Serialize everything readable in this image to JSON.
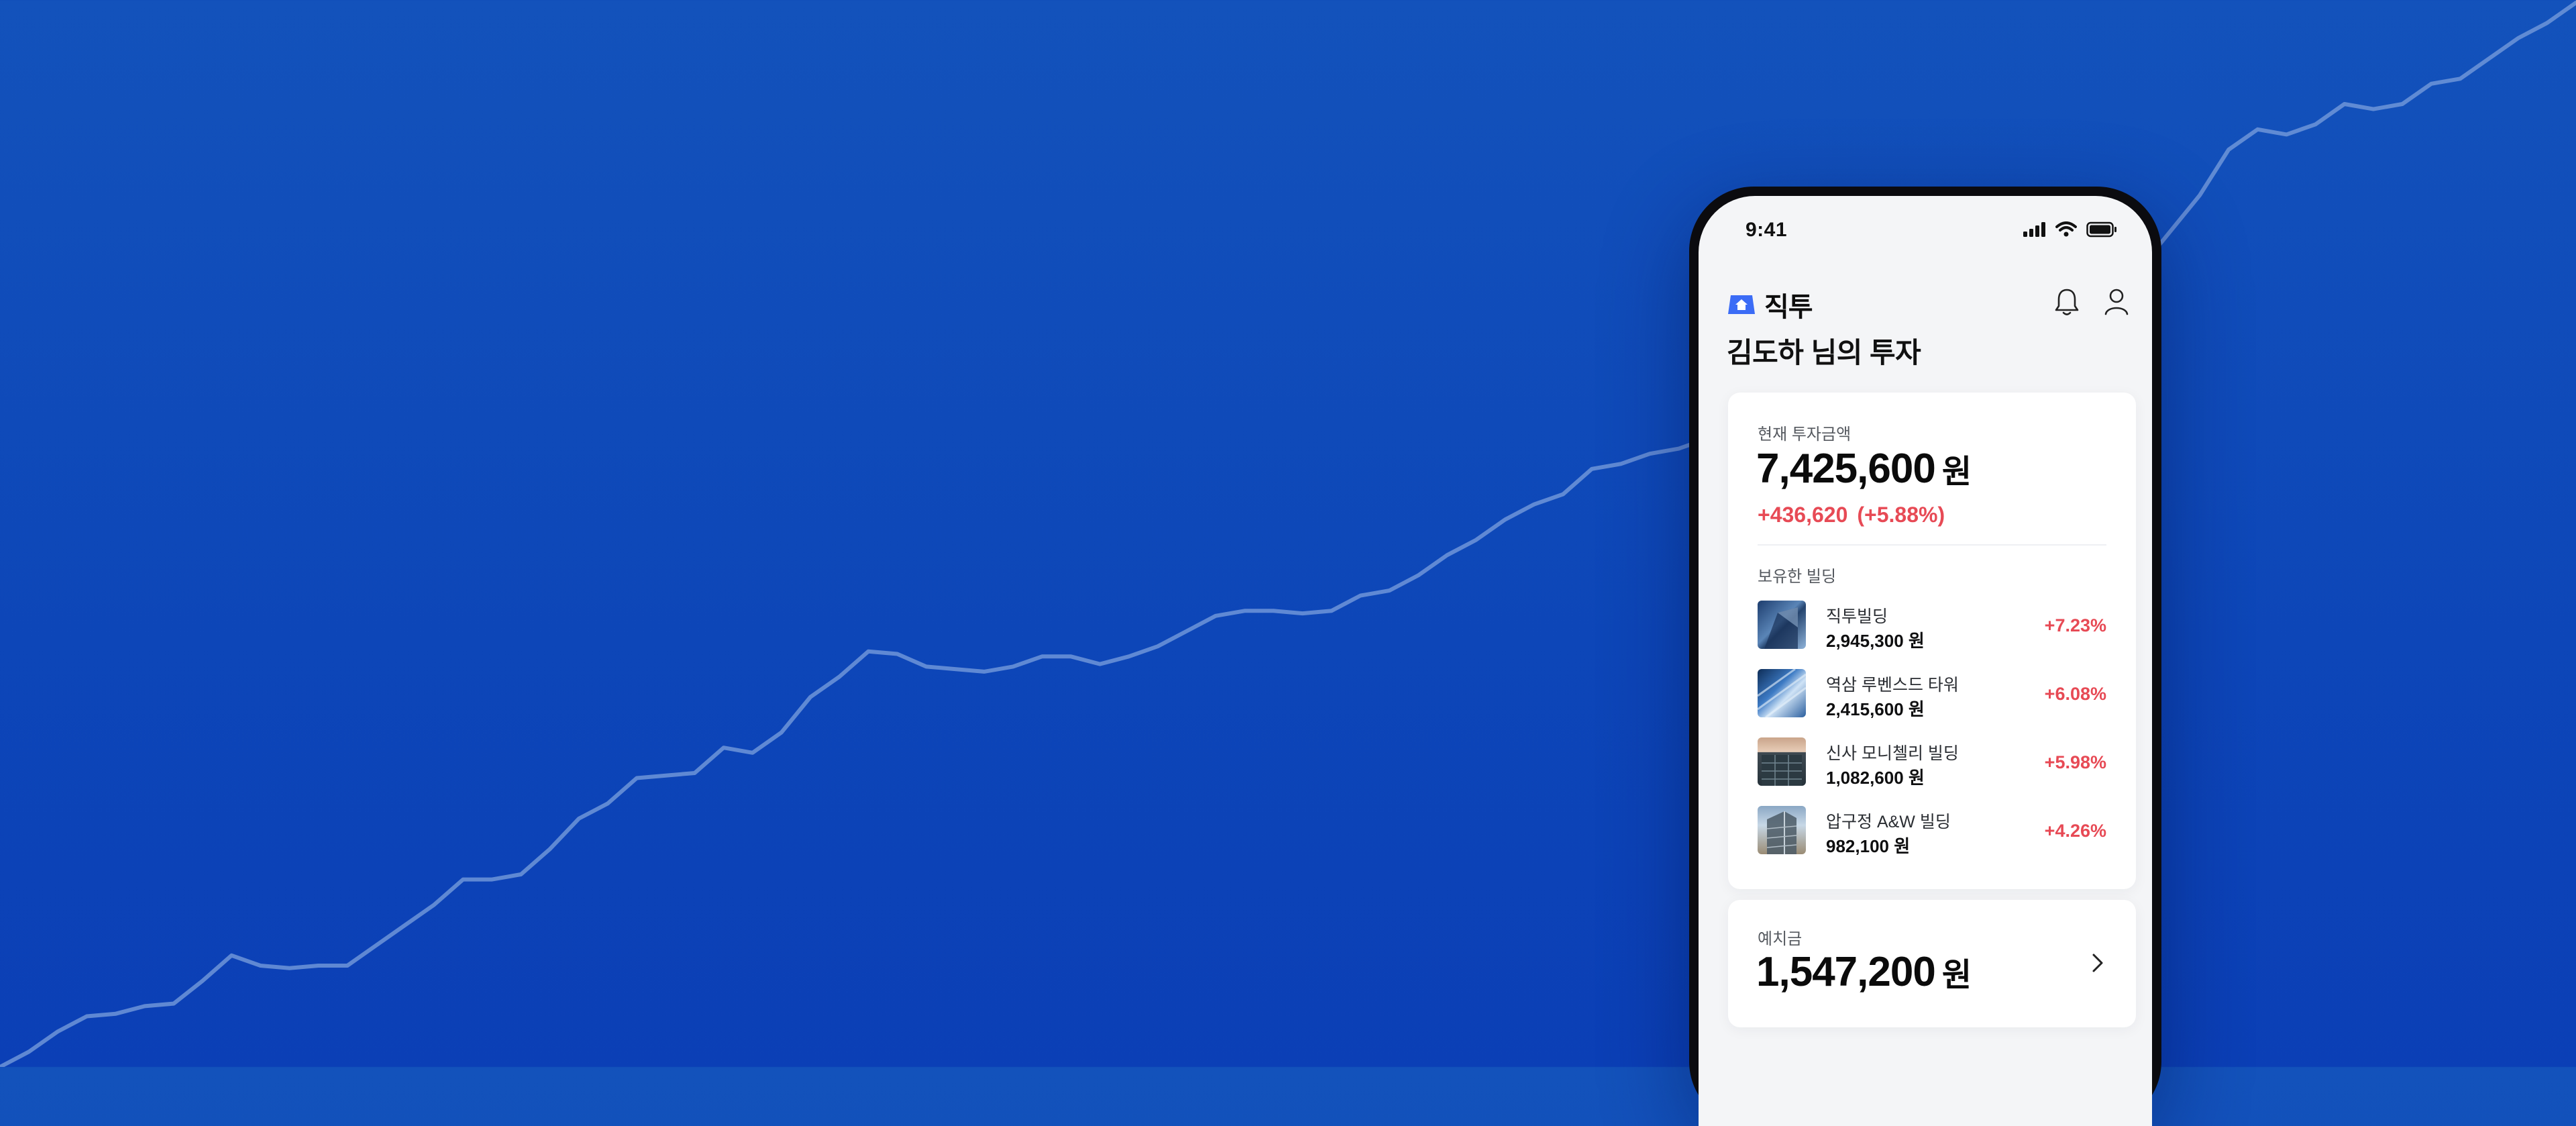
{
  "colors": {
    "accent_blue": "#1352bb",
    "positive_red": "#e74a55",
    "logo_blue": "#3b6cf6"
  },
  "status_bar": {
    "time": "9:41"
  },
  "header": {
    "logo_text": "직투",
    "icons": [
      "bell-icon",
      "user-icon"
    ]
  },
  "greeting": "김도하 님의 투자",
  "investment": {
    "label": "현재 투자금액",
    "amount": "7,425,600",
    "unit": "원",
    "change_amount": "+436,620",
    "change_percent": "(+5.88%)",
    "buildings_label": "보유한 빌딩",
    "buildings": [
      {
        "name": "직투빌딩",
        "amount": "2,945,300 원",
        "change": "+7.23%"
      },
      {
        "name": "역삼 루벤스드 타워",
        "amount": "2,415,600 원",
        "change": "+6.08%"
      },
      {
        "name": "신사 모니첼리 빌딩",
        "amount": "1,082,600 원",
        "change": "+5.98%"
      },
      {
        "name": "압구정 A&W 빌딩",
        "amount": "982,100 원",
        "change": "+4.26%"
      }
    ]
  },
  "deposit": {
    "label": "예치금",
    "amount": "1,547,200",
    "unit": "원"
  },
  "background_line": {
    "color": "#6f95d8",
    "values": [
      0,
      3,
      7,
      10,
      10.5,
      12,
      12.5,
      17,
      22,
      20,
      19.5,
      20,
      20,
      24,
      28,
      32,
      37,
      37,
      38,
      43,
      49,
      52,
      57,
      57.5,
      58,
      63,
      62,
      66,
      73,
      77,
      82,
      81.5,
      79,
      78.5,
      78,
      79,
      81,
      81,
      79.5,
      81,
      83,
      86,
      89,
      90,
      90,
      89.5,
      90,
      93,
      94,
      97,
      101,
      104,
      108,
      111,
      113,
      118,
      119,
      121,
      122,
      124,
      124.5,
      127,
      128,
      130,
      131,
      133,
      134,
      135,
      137,
      138,
      141,
      145,
      148,
      152,
      158,
      165,
      172,
      181,
      185,
      184,
      186,
      190,
      189,
      190,
      194,
      195,
      199,
      203,
      206,
      210
    ]
  }
}
